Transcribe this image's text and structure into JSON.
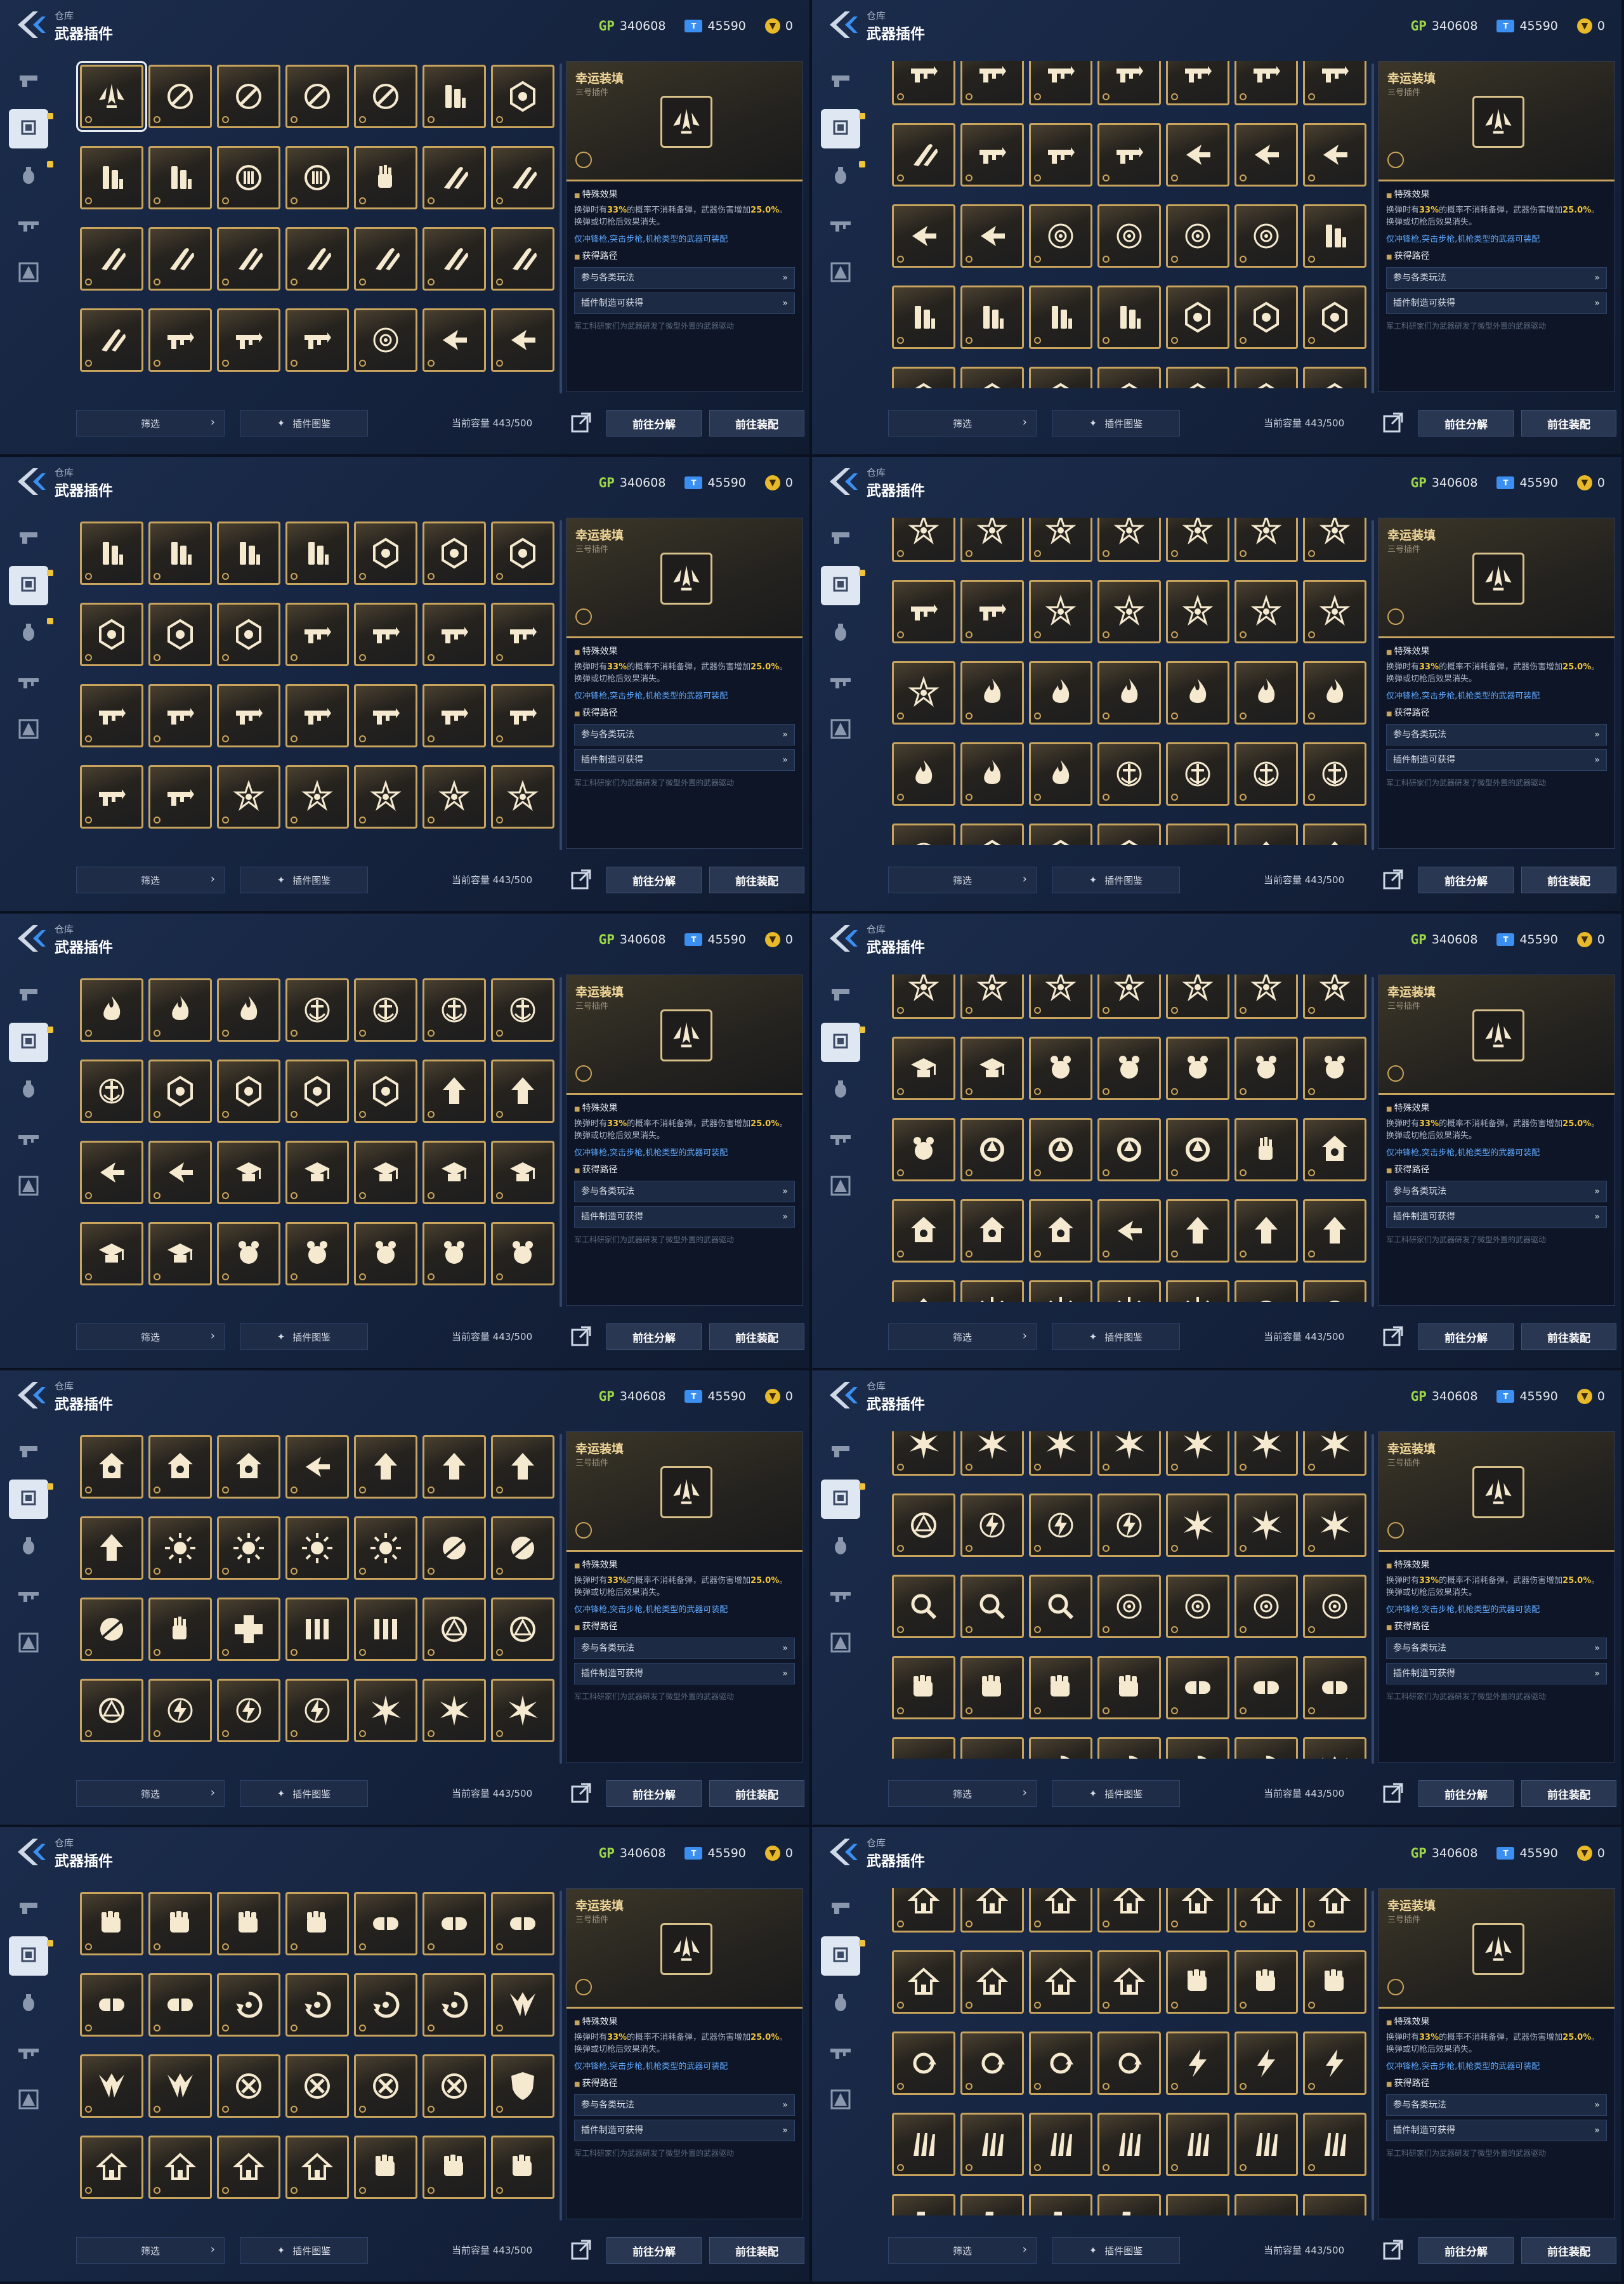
{
  "header": {
    "breadcrumb": "仓库",
    "title": "武器插件",
    "gp_label": "GP",
    "gp_value": "340608",
    "ticket_label": "T",
    "ticket_value": "45590",
    "coin_value": "0"
  },
  "sidebar": [
    "pistol-icon",
    "chip-icon",
    "grenade-icon",
    "rifle-icon",
    "character-icon"
  ],
  "detail": {
    "name": "幸运装填",
    "subtitle": "三号插件",
    "effect_heading": "特殊效果",
    "effect_pre": "换弹时有",
    "effect_pct1": "33%",
    "effect_mid": "的概率不消耗备弹，武器伤害增加",
    "effect_pct2": "25.0%",
    "effect_post": "。换弹或切枪后效果消失。",
    "compat": "仅冲锋枪,突击步枪,机枪类型的武器可装配",
    "source_heading": "获得路径",
    "source1": "参与各类玩法",
    "source2": "插件制造可获得",
    "lore": "军工科研家们为武器研发了微型外置的武器驱动"
  },
  "footer": {
    "filter": "筛选",
    "atlas": "插件图鉴",
    "capacity_label": "当前容量",
    "capacity_value": "443/500",
    "dismantle": "前往分解",
    "equip": "前往装配"
  },
  "panels": [
    {
      "offset": 0,
      "rows": [
        [
          "wings",
          "crossed",
          "crossed",
          "crossed",
          "crossed",
          "mag",
          "hex"
        ],
        [
          "mag",
          "mag",
          "drum",
          "drum",
          "hand",
          "bullet",
          "bullet"
        ],
        [
          "bullet",
          "bullet",
          "bullet",
          "bullet",
          "bullet",
          "bullet",
          "bullet"
        ],
        [
          "bullet",
          "gun",
          "gun",
          "gun",
          "target",
          "arrow",
          "arrow"
        ]
      ]
    },
    {
      "offset": -36,
      "rows": [
        [
          "gun",
          "gun",
          "gun",
          "gun",
          "gun",
          "gun",
          "gun"
        ],
        [
          "bullet",
          "gun",
          "gun",
          "gun",
          "arrow",
          "arrow",
          "arrow"
        ],
        [
          "arrow",
          "arrow",
          "target",
          "target",
          "target",
          "target",
          "mag"
        ],
        [
          "mag",
          "mag",
          "mag",
          "mag",
          "hex",
          "hex",
          "hex"
        ],
        [
          "hex",
          "hex",
          "hex",
          "hex",
          "hex",
          "hex",
          "hex"
        ]
      ]
    },
    {
      "offset": 0,
      "rows": [
        [
          "mag",
          "mag",
          "mag",
          "mag",
          "hex",
          "hex",
          "hex"
        ],
        [
          "hex",
          "hex",
          "hex",
          "gun",
          "gun",
          "gun",
          "gun"
        ],
        [
          "gun",
          "gun",
          "gun",
          "gun",
          "gun",
          "gun",
          "gun"
        ],
        [
          "gun",
          "gun",
          "star",
          "star",
          "star",
          "star",
          "star"
        ]
      ]
    },
    {
      "offset": -36,
      "rows": [
        [
          "star",
          "star",
          "star",
          "star",
          "star",
          "star",
          "star"
        ],
        [
          "gun",
          "gun",
          "star",
          "star",
          "star",
          "star",
          "star"
        ],
        [
          "star",
          "fire",
          "fire",
          "fire",
          "fire",
          "fire",
          "fire"
        ],
        [
          "fire",
          "fire",
          "fire",
          "anchor",
          "anchor",
          "anchor",
          "anchor"
        ],
        [
          "anchor",
          "hex",
          "hex",
          "hex",
          "arrow",
          "up",
          "up"
        ]
      ]
    },
    {
      "offset": 0,
      "rows": [
        [
          "fire",
          "fire",
          "fire",
          "anchor",
          "anchor",
          "anchor",
          "anchor"
        ],
        [
          "anchor",
          "hex",
          "hex",
          "hex",
          "hex",
          "up",
          "up"
        ],
        [
          "arrow",
          "arrow",
          "cap",
          "cap",
          "cap",
          "cap",
          "cap"
        ],
        [
          "cap",
          "cap",
          "kettle",
          "kettle",
          "kettle",
          "kettle",
          "kettle"
        ]
      ]
    },
    {
      "offset": -36,
      "rows": [
        [
          "star",
          "star",
          "star",
          "star",
          "star",
          "star",
          "star"
        ],
        [
          "cap",
          "cap",
          "kettle",
          "kettle",
          "kettle",
          "kettle",
          "kettle"
        ],
        [
          "kettle",
          "ring",
          "ring",
          "ring",
          "ring",
          "hand",
          "house"
        ],
        [
          "house",
          "house",
          "house",
          "arrow",
          "up",
          "up",
          "up"
        ],
        [
          "up",
          "sun",
          "sun",
          "sun",
          "sun",
          "slash",
          "slash"
        ]
      ]
    },
    {
      "offset": 0,
      "rows": [
        [
          "house",
          "house",
          "house",
          "arrow",
          "up",
          "up",
          "up"
        ],
        [
          "up",
          "sun",
          "sun",
          "sun",
          "sun",
          "slash",
          "slash"
        ],
        [
          "slash",
          "hand",
          "cross",
          "bars",
          "bars",
          "circle",
          "circle"
        ],
        [
          "circle",
          "bolt",
          "bolt",
          "bolt",
          "burst",
          "burst",
          "burst"
        ]
      ]
    },
    {
      "offset": -36,
      "rows": [
        [
          "burst",
          "burst",
          "burst",
          "burst",
          "burst",
          "burst",
          "burst"
        ],
        [
          "circle",
          "bolt",
          "bolt",
          "bolt",
          "burst",
          "burst",
          "burst"
        ],
        [
          "magnify",
          "magnify",
          "magnify",
          "target",
          "target",
          "target",
          "target"
        ],
        [
          "fist",
          "fist",
          "fist",
          "fist",
          "pill",
          "pill",
          "pill"
        ],
        [
          "pill",
          "pill",
          "swirl",
          "swirl",
          "swirl",
          "swirl",
          "wing"
        ]
      ]
    },
    {
      "offset": 0,
      "rows": [
        [
          "fist",
          "fist",
          "fist",
          "fist",
          "pill",
          "pill",
          "pill"
        ],
        [
          "pill",
          "pill",
          "swirl",
          "swirl",
          "swirl",
          "swirl",
          "wing"
        ],
        [
          "wing",
          "wing",
          "x",
          "x",
          "x",
          "x",
          "shield"
        ],
        [
          "home",
          "home",
          "home",
          "home",
          "fist",
          "fist",
          "fist"
        ]
      ]
    },
    {
      "offset": -36,
      "rows": [
        [
          "home",
          "home",
          "home",
          "home",
          "home",
          "home",
          "home"
        ],
        [
          "home",
          "home",
          "home",
          "home",
          "fist",
          "fist",
          "fist"
        ],
        [
          "cycle",
          "cycle",
          "cycle",
          "cycle",
          "bolt2",
          "bolt2",
          "bolt2"
        ],
        [
          "claw",
          "claw",
          "claw",
          "claw",
          "claw",
          "claw",
          "claw"
        ],
        [
          "boot",
          "boot",
          "boot",
          "boot",
          "jet",
          "jet",
          "jet"
        ]
      ]
    }
  ],
  "colors": {
    "gold": "#c9a45c",
    "accent_blue": "#3a8ff0",
    "gp_green": "#9cd646",
    "coin": "#e8b928"
  }
}
